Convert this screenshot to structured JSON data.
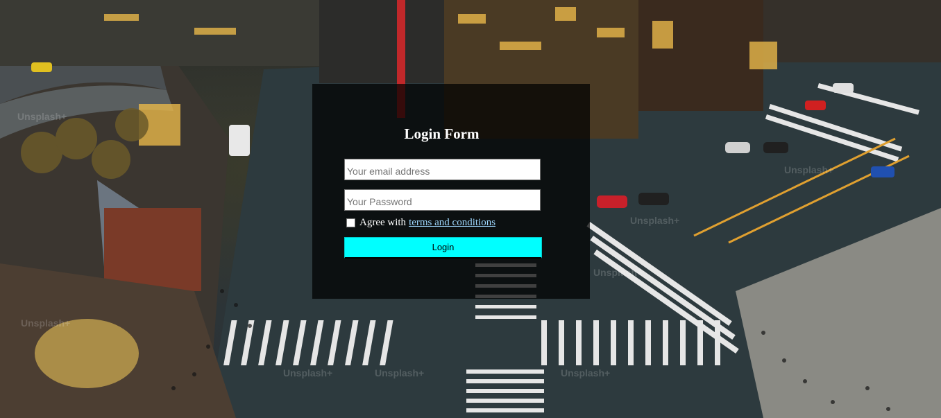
{
  "background": {
    "watermark_text": "Unsplash+"
  },
  "login": {
    "title": "Login Form",
    "email_placeholder": "Your email address",
    "password_placeholder": "Your Password",
    "agree_text": "Agree with",
    "terms_link_text": "terms and conditions",
    "button_label": "Login",
    "button_color": "#00ffff",
    "link_color": "#9fd8ff"
  }
}
